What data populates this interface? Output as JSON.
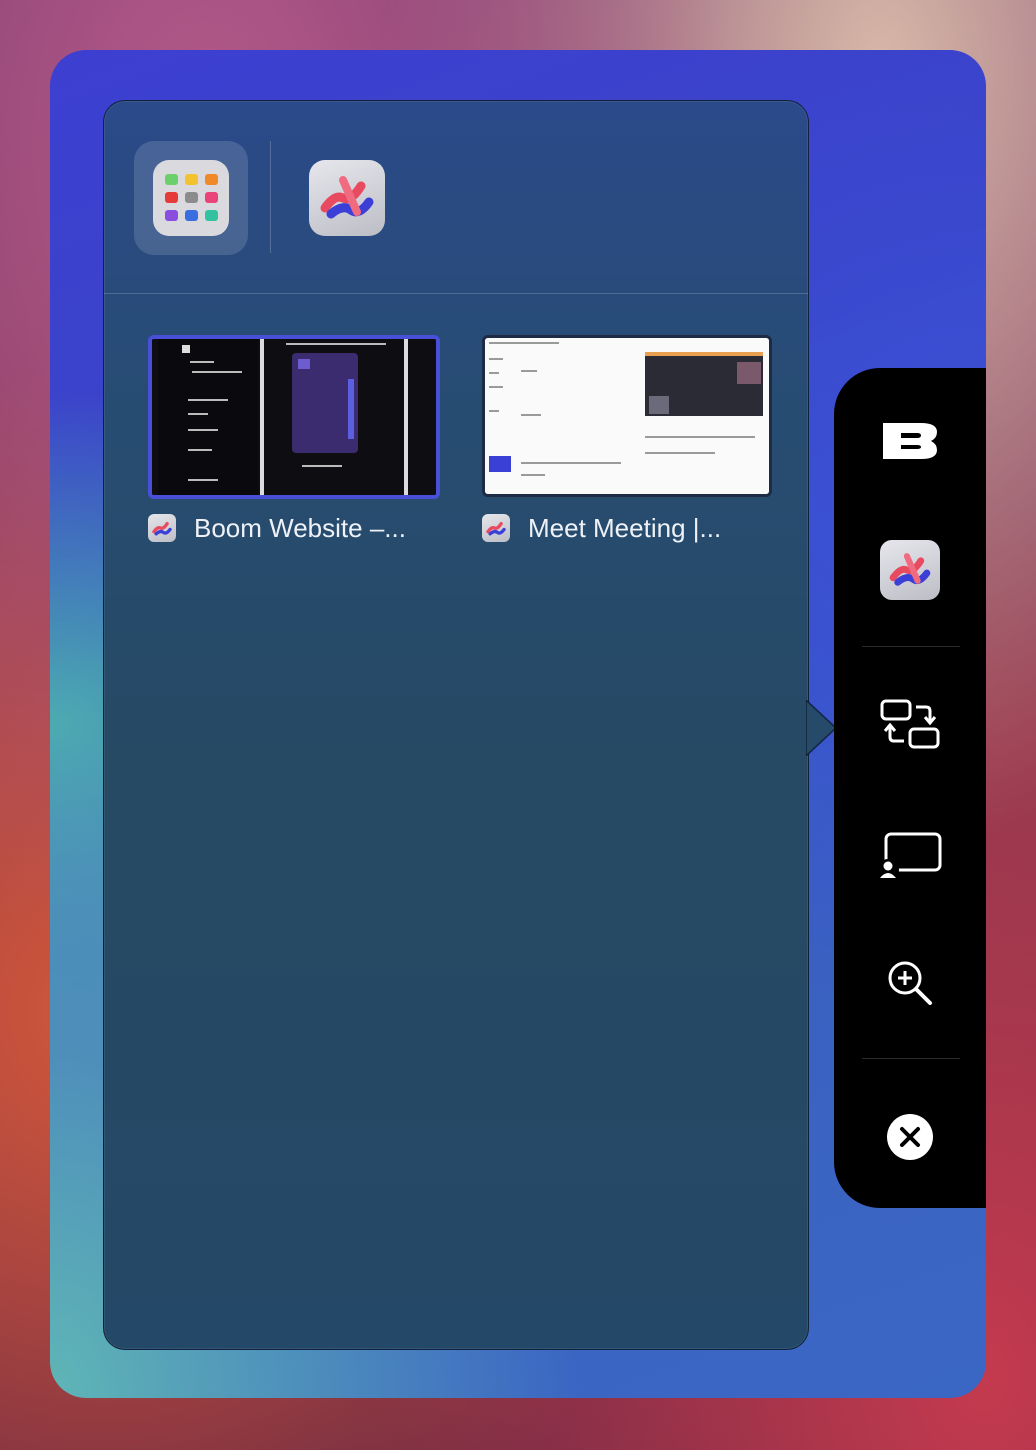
{
  "switcher": {
    "apps": [
      {
        "name": "launcher",
        "icon": "app-grid-icon",
        "selected": true
      },
      {
        "name": "arc",
        "icon": "arc-browser-icon",
        "selected": false
      }
    ],
    "windows": [
      {
        "title": "Boom Website –...",
        "icon": "arc-browser-icon",
        "selected": true
      },
      {
        "title": "Meet Meeting |...",
        "icon": "arc-browser-icon",
        "selected": false
      }
    ]
  },
  "toolbar": {
    "items": [
      {
        "name": "boom-logo",
        "icon": "boom-b-logo-icon",
        "label": "B"
      },
      {
        "name": "arc-app",
        "icon": "arc-browser-icon"
      },
      {
        "name": "switch-window",
        "icon": "switch-windows-icon"
      },
      {
        "name": "share-screen",
        "icon": "screen-share-icon"
      },
      {
        "name": "zoom",
        "icon": "zoom-in-icon"
      },
      {
        "name": "close",
        "icon": "close-icon"
      }
    ]
  },
  "colors": {
    "accent": "#4a4fd8",
    "toolbar_bg": "#000000",
    "panel_bg": "#264a6a"
  }
}
